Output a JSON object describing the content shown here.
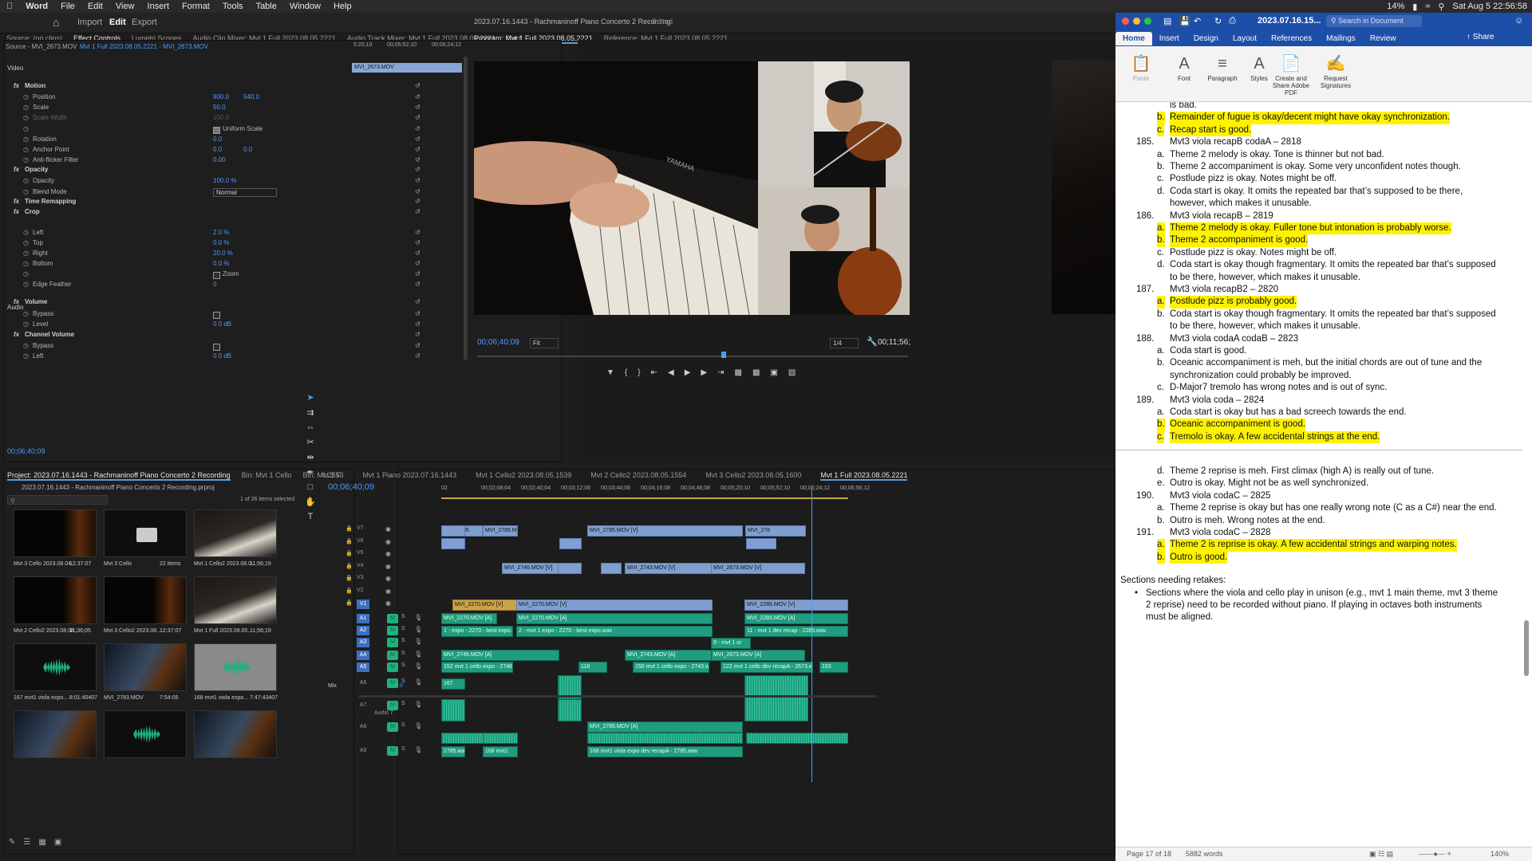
{
  "menubar": {
    "apple": "",
    "items": [
      "Word",
      "File",
      "Edit",
      "View",
      "Insert",
      "Format",
      "Tools",
      "Table",
      "Window",
      "Help"
    ],
    "battery": "14%",
    "datetime": "Sat Aug 5  22:56:58"
  },
  "premiere": {
    "nav": {
      "import": "Import",
      "edit": "Edit",
      "export": "Export"
    },
    "title": "2023.07.16.1443 - Rachmaninoff Piano Concerto 2 Recording",
    "edited": "- Edited",
    "source_tabs": [
      "Source: (no clips)",
      "Effect Controls",
      "Lumetri Scopes",
      "Audio Clip Mixer: Mvt 1 Full 2023.08.05.2221",
      "Audio Track Mixer: Mvt 1 Full 2023.08.05.2221",
      "Capt"
    ],
    "program_tabs": [
      "Program: Mvt 1 Full 2023.08.05.2221",
      "Reference: Mvt 1 Full 2023.08.05.2221"
    ],
    "effect_controls": {
      "source_label": "Source - MVI_2673.MOV",
      "seq_label": "Mvt 1 Full 2023.08.05.2221 - MVI_2673.MOV",
      "ruler": [
        "5:20;10",
        "00;05;52;10",
        "00;06;24;12"
      ],
      "clip_name": "MVI_2673.MOV",
      "video_header": "Video",
      "audio_header": "Audio",
      "rows": [
        {
          "label": "Motion",
          "type": "fx"
        },
        {
          "label": "Position",
          "v1": "900.0",
          "v2": "540.0"
        },
        {
          "label": "Scale",
          "v1": "50.0"
        },
        {
          "label": "Scale Width",
          "v1": "100.0",
          "dim": true
        },
        {
          "label": "Uniform Scale",
          "check": true
        },
        {
          "label": "Rotation",
          "v1": "0.0"
        },
        {
          "label": "Anchor Point",
          "v1": "0.0",
          "v2": "0.0"
        },
        {
          "label": "Anti-flicker Filter",
          "v1": "0.00"
        },
        {
          "label": "Opacity",
          "type": "fx"
        },
        {
          "label": "Opacity",
          "v1": "100.0 %"
        },
        {
          "label": "Blend Mode",
          "select": "Normal"
        },
        {
          "label": "Time Remapping",
          "type": "fx"
        },
        {
          "label": "Crop",
          "type": "fx"
        },
        {
          "label": "Left",
          "v1": "2.0 %"
        },
        {
          "label": "Top",
          "v1": "0.0 %"
        },
        {
          "label": "Right",
          "v1": "20.0 %"
        },
        {
          "label": "Bottom",
          "v1": "0.0 %"
        },
        {
          "label": "Zoom",
          "check": false
        },
        {
          "label": "Edge Feather",
          "v1": "0"
        },
        {
          "label": "Volume",
          "type": "fx"
        },
        {
          "label": "Bypass",
          "check": false
        },
        {
          "label": "Level",
          "v1": "0.0 dB"
        },
        {
          "label": "Channel Volume",
          "type": "fx"
        },
        {
          "label": "Bypass",
          "check": false
        },
        {
          "label": "Left",
          "v1": "0.0 dB"
        }
      ],
      "timecode": "00;06;40;09"
    },
    "program": {
      "timecode": "00;06;40;09",
      "fit": "Fit",
      "quality": "1/4",
      "duration": "00;11;56;"
    },
    "project": {
      "tabs": [
        "Project: 2023.07.16.1443 - Rachmaninoff Piano Concerto 2 Recording",
        "Bin: Mvt 1 Cello",
        "Bin: Mvt 2 F"
      ],
      "file": "2023.07.16.1443 - Rachmaninoff Piano Concerto 2 Recording.prproj",
      "selected": "1 of 26 items selected",
      "items": [
        {
          "name": "Mvt 3 Cello 2023.08.04...",
          "dur": "12:37:07",
          "kind": "cello"
        },
        {
          "name": "Mvt 3 Cello",
          "dur": "22 items",
          "kind": "folder"
        },
        {
          "name": "Mvt 1 Cello2 2023.08.0...",
          "dur": "11;56;19",
          "kind": "piano"
        },
        {
          "name": "Mvt 2 Cello2 2023.08.08...",
          "dur": "11;36;05",
          "kind": "cello"
        },
        {
          "name": "Mvt 3 Cello2 2023.08...",
          "dur": "12:37:07",
          "kind": "cello"
        },
        {
          "name": "Mvt 1 Full 2023.08.05...",
          "dur": "11;56;19",
          "kind": "piano"
        },
        {
          "name": "167 mvt1 viola expo...",
          "dur": "8:01:40407",
          "kind": "audio"
        },
        {
          "name": "MVI_2783.MOV",
          "dur": "7:54:05",
          "kind": "violin"
        },
        {
          "name": "168 mvt1 viola expo...",
          "dur": "7:47:43407",
          "kind": "audio-sel"
        },
        {
          "name": "",
          "dur": "",
          "kind": "violin"
        },
        {
          "name": "",
          "dur": "",
          "kind": "audio"
        },
        {
          "name": "",
          "dur": "",
          "kind": "violin"
        }
      ]
    },
    "timeline": {
      "tabs": [
        "4.2553",
        "Mvt 1 Piano 2023.07.16.1443",
        "Mvt 1 Cello2 2023.08.05.1539",
        "Mvt 2 Cello2 2023.08.05.1554",
        "Mvt 3 Cello2 2023.08.05.1600",
        "Mvt 1 Full 2023.08.05.2221"
      ],
      "timecode": "00;06;40;09",
      "ruler": [
        "02",
        "00;02;08;04",
        "00;02;40;04",
        "00;03;12;06",
        "00;03;44;06",
        "00;04;16;08",
        "00;04;48;08",
        "00;05;20;10",
        "00;05;52;10",
        "00;06;24;12",
        "00;06;56;12"
      ],
      "video_tracks": [
        "V7",
        "V6",
        "V5",
        "V4",
        "V3",
        "V2",
        "V1"
      ],
      "audio_tracks": [
        "A1",
        "A2",
        "A3",
        "A4",
        "A5",
        "A6",
        "A7",
        "A8",
        "A9"
      ],
      "audio7_name": "Audio 7",
      "mix": "Mix",
      "mix_val": "0.0",
      "clips_v": [
        {
          "t": "MVI_2785",
          "row": 0,
          "k": "v"
        },
        {
          "t": "MVI_2785.MOV [V]",
          "row": 0,
          "k": "v"
        },
        {
          "t": "MVI_2785.MOV [V]",
          "row": 0,
          "k": "v"
        },
        {
          "t": "MVI_278",
          "row": 0,
          "k": "v"
        },
        {
          "t": "MVI_2746.MOV [V]",
          "row": 3,
          "k": "v"
        },
        {
          "t": "MVI_2743.MOV [V]",
          "row": 3,
          "k": "v"
        },
        {
          "t": "MVI_2673.MOV [V]",
          "row": 3,
          "k": "v"
        },
        {
          "t": "MVI_2270.MOV [V]",
          "row": 6,
          "k": "y"
        },
        {
          "t": "MVI_2270.MOV [V]",
          "row": 6,
          "k": "v"
        },
        {
          "t": "MVI_2285.MOV [V]",
          "row": 6,
          "k": "v"
        }
      ],
      "clips_a": [
        "MVI_2270.MOV [A]",
        "MVI_2270.MOV [A]",
        "MVI_2285.MOV [A]",
        "1 - expo - 2270 - best expo.wav",
        "2 - mvt 1 expo - 2270 - best expo.wav",
        "11 - mvt 1 dev recap - 2285.wav",
        "9 - mvt 1 or",
        "MVI_2746.MOV [A]",
        "MVI_2743.MOV [A]",
        "MVI_2673.MOV [A]",
        "152 mvt 1 cello expo - 2746.wav",
        "118",
        "150 mvt 1 cello expo - 2743.wav",
        "122 mvt 1 cello dev recapA - 2673.wav",
        "153",
        "MVI_2785.MOV [A]",
        "2785.wav",
        "168 mvt1",
        "168 mvt1 viola expo dev recapA - 2785.wav",
        "167"
      ]
    }
  },
  "word": {
    "title": "2023.07.16.15...",
    "search_placeholder": "Search in Document",
    "tabs": [
      "Home",
      "Insert",
      "Design",
      "Layout",
      "References",
      "Mailings",
      "Review"
    ],
    "share": "Share",
    "ribbon": [
      "Paste",
      "Font",
      "Paragraph",
      "Styles",
      "Create and Share Adobe PDF",
      "Request Signatures"
    ],
    "status_page": "Page 17 of 18",
    "status_words": "5882 words",
    "zoom": "140%"
  },
  "document": {
    "lines": [
      {
        "n": "",
        "m": "",
        "t": "is bad.",
        "h": false,
        "x": 1
      },
      {
        "n": "",
        "m": "b.",
        "t": "Remainder of fugue is okay/decent might have okay synchronization.",
        "h": true,
        "x": 1
      },
      {
        "n": "",
        "m": "c.",
        "t": "Recap start is good.",
        "h": true,
        "x": 1
      },
      {
        "n": "185.",
        "m": "",
        "t": "Mvt3 viola recapB codaA – 2818",
        "h": false,
        "x": 0
      },
      {
        "n": "",
        "m": "a.",
        "t": "Theme 2 melody is okay. Tone is thinner but not bad.",
        "h": false,
        "x": 1
      },
      {
        "n": "",
        "m": "b.",
        "t": "Theme 2 accompaniment is okay. Some very unconfident notes though.",
        "h": false,
        "x": 1
      },
      {
        "n": "",
        "m": "c.",
        "t": "Postlude pizz is okay. Notes might be off.",
        "h": false,
        "x": 1
      },
      {
        "n": "",
        "m": "d.",
        "t": "Coda start is okay. It omits the repeated bar that’s supposed to be there,",
        "h": false,
        "x": 1
      },
      {
        "n": "",
        "m": "",
        "t": "however, which makes it unusable.",
        "h": false,
        "x": 1
      },
      {
        "n": "186.",
        "m": "",
        "t": "Mvt3 viola recapB – 2819",
        "h": false,
        "x": 0
      },
      {
        "n": "",
        "m": "a.",
        "t": "Theme 2 melody is okay. Fuller tone but intonation is probably worse.",
        "h": true,
        "x": 1
      },
      {
        "n": "",
        "m": "b.",
        "t": "Theme 2 accompaniment is good.",
        "h": true,
        "x": 1
      },
      {
        "n": "",
        "m": "c.",
        "t": "Postlude pizz is okay. Notes might be off.",
        "h": false,
        "x": 1
      },
      {
        "n": "",
        "m": "d.",
        "t": "Coda start is okay though fragmentary. It omits the repeated bar that’s supposed",
        "h": false,
        "x": 1
      },
      {
        "n": "",
        "m": "",
        "t": "to be there, however, which makes it unusable.",
        "h": false,
        "x": 1
      },
      {
        "n": "187.",
        "m": "",
        "t": "Mvt3 viola recapB2 – 2820",
        "h": false,
        "x": 0
      },
      {
        "n": "",
        "m": "a.",
        "t": "Postlude pizz is probably good.",
        "h": true,
        "x": 1
      },
      {
        "n": "",
        "m": "b.",
        "t": "Coda start is okay though fragmentary. It omits the repeated bar that’s supposed",
        "h": false,
        "x": 1
      },
      {
        "n": "",
        "m": "",
        "t": "to be there, however, which makes it unusable.",
        "h": false,
        "x": 1
      },
      {
        "n": "188.",
        "m": "",
        "t": "Mvt3 viola codaA codaB – 2823",
        "h": false,
        "x": 0
      },
      {
        "n": "",
        "m": "a.",
        "t": "Coda start is good.",
        "h": false,
        "x": 1
      },
      {
        "n": "",
        "m": "b.",
        "t": "Oceanic accompaniment is meh, but the initial chords are out of tune and the",
        "h": false,
        "x": 1
      },
      {
        "n": "",
        "m": "",
        "t": "synchronization could probably be improved.",
        "h": false,
        "x": 1
      },
      {
        "n": "",
        "m": "c.",
        "t": "D-Major7 tremolo has wrong notes and is out of sync.",
        "h": false,
        "x": 1
      },
      {
        "n": "189.",
        "m": "",
        "t": "Mvt3 viola coda – 2824",
        "h": false,
        "x": 0
      },
      {
        "n": "",
        "m": "a.",
        "t": "Coda start is okay but has a bad screech towards the end.",
        "h": false,
        "x": 1
      },
      {
        "n": "",
        "m": "b.",
        "t": "Oceanic accompaniment is good.",
        "h": true,
        "x": 1
      },
      {
        "n": "",
        "m": "c.",
        "t": "Tremolo is okay. A few accidental strings at the end.",
        "h": true,
        "x": 1
      }
    ],
    "lines2": [
      {
        "n": "",
        "m": "d.",
        "t": "Theme 2 reprise is meh. First climax (high A) is really out of tune.",
        "h": false,
        "x": 1
      },
      {
        "n": "",
        "m": "e.",
        "t": "Outro is okay. Might not be as well synchronized.",
        "h": false,
        "x": 1
      },
      {
        "n": "190.",
        "m": "",
        "t": "Mvt3 viola codaC – 2825",
        "h": false,
        "x": 0
      },
      {
        "n": "",
        "m": "a.",
        "t": "Theme 2 reprise is okay but has one really wrong note (C as a C#) near the end.",
        "h": false,
        "x": 1
      },
      {
        "n": "",
        "m": "b.",
        "t": "Outro is meh. Wrong notes at the end.",
        "h": false,
        "x": 1
      },
      {
        "n": "191.",
        "m": "",
        "t": "Mvt3 viola codaC – 2828",
        "h": false,
        "x": 0
      },
      {
        "n": "",
        "m": "a.",
        "t": "Theme 2 is reprise is okay. A few accidental strings and warping notes.",
        "h": true,
        "x": 1
      },
      {
        "n": "",
        "m": "b.",
        "t": "Outro is good.",
        "h": true,
        "x": 1
      }
    ],
    "retakes_heading": "Sections needing retakes:",
    "retakes": [
      "Sections where the viola and cello play in unison (e.g., mvt 1 main theme, mvt 3 theme",
      "2 reprise) need to be recorded without piano. If playing in octaves both instruments",
      "must be aligned."
    ]
  }
}
